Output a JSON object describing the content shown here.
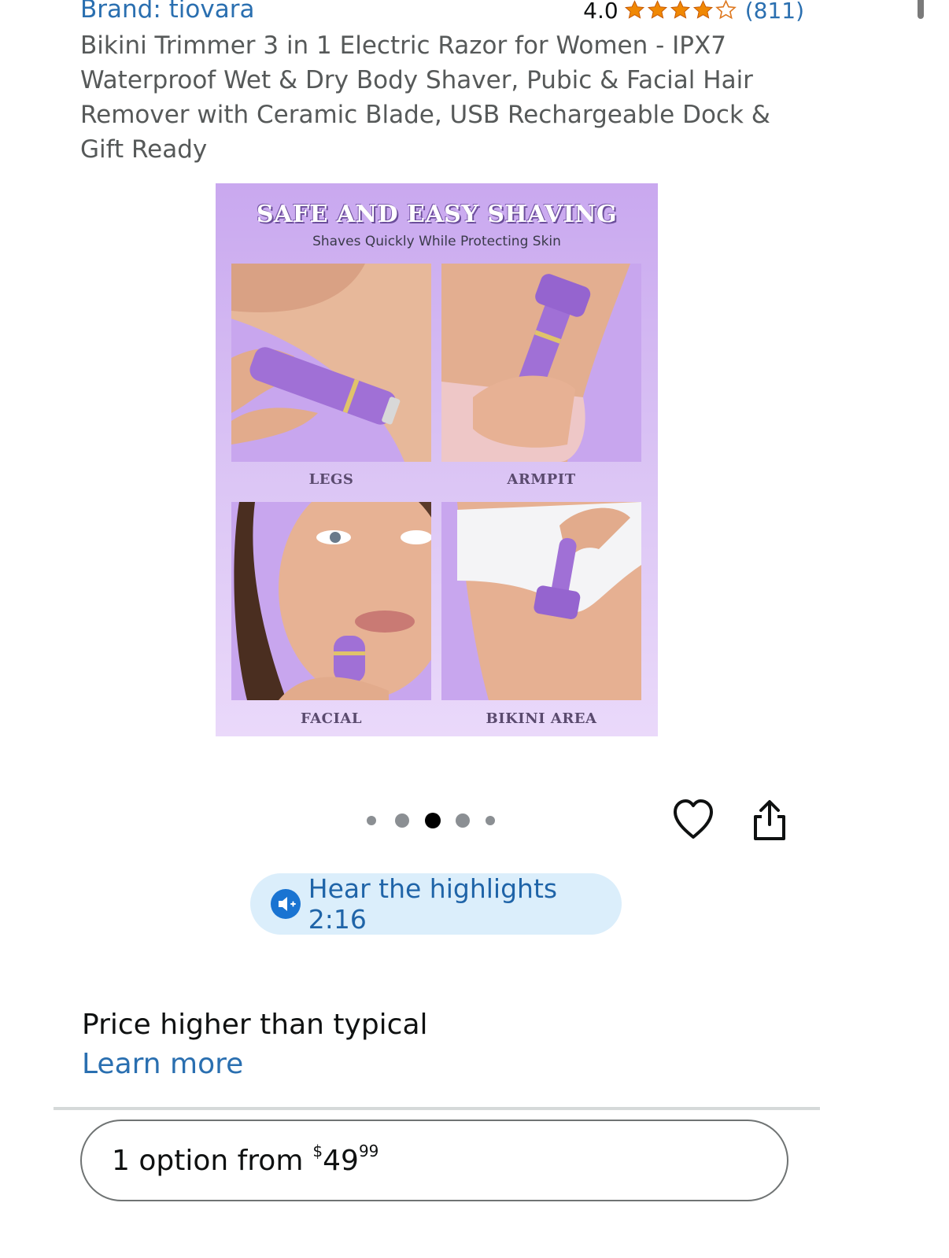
{
  "header": {
    "brand_link": "Brand: tiovara",
    "rating_value": "4.0",
    "rating_stars": 4,
    "rating_count": "(811)"
  },
  "product": {
    "title": "Bikini Trimmer 3 in 1 Electric Razor for Women - IPX7 Waterproof Wet & Dry Body Shaver, Pubic & Facial Hair Remover with Ceramic Blade, USB Rechargeable Dock & Gift Ready"
  },
  "gallery": {
    "headline": "SAFE AND EASY SHAVING",
    "subline": "Shaves Quickly While Protecting Skin",
    "tiles": [
      {
        "label": "LEGS"
      },
      {
        "label": "ARMPIT"
      },
      {
        "label": "FACIAL"
      },
      {
        "label": "BIKINI AREA"
      }
    ],
    "dot_count": 5,
    "active_dot": 3
  },
  "actions": {
    "wishlist_icon": "heart-icon",
    "share_icon": "share-icon"
  },
  "audio": {
    "label": "Hear the highlights 2:16",
    "icon": "speaker-icon"
  },
  "pricing": {
    "note": "Price higher than typical",
    "learn_more": "Learn more",
    "options_text": "1 option from",
    "price_symbol": "$",
    "price_whole": "49",
    "price_fraction": "99"
  },
  "colors": {
    "link": "#2a6fb0",
    "star": "#f08804",
    "accent_purple": "#c9a8ef",
    "pill_bg": "#dbeefb"
  }
}
